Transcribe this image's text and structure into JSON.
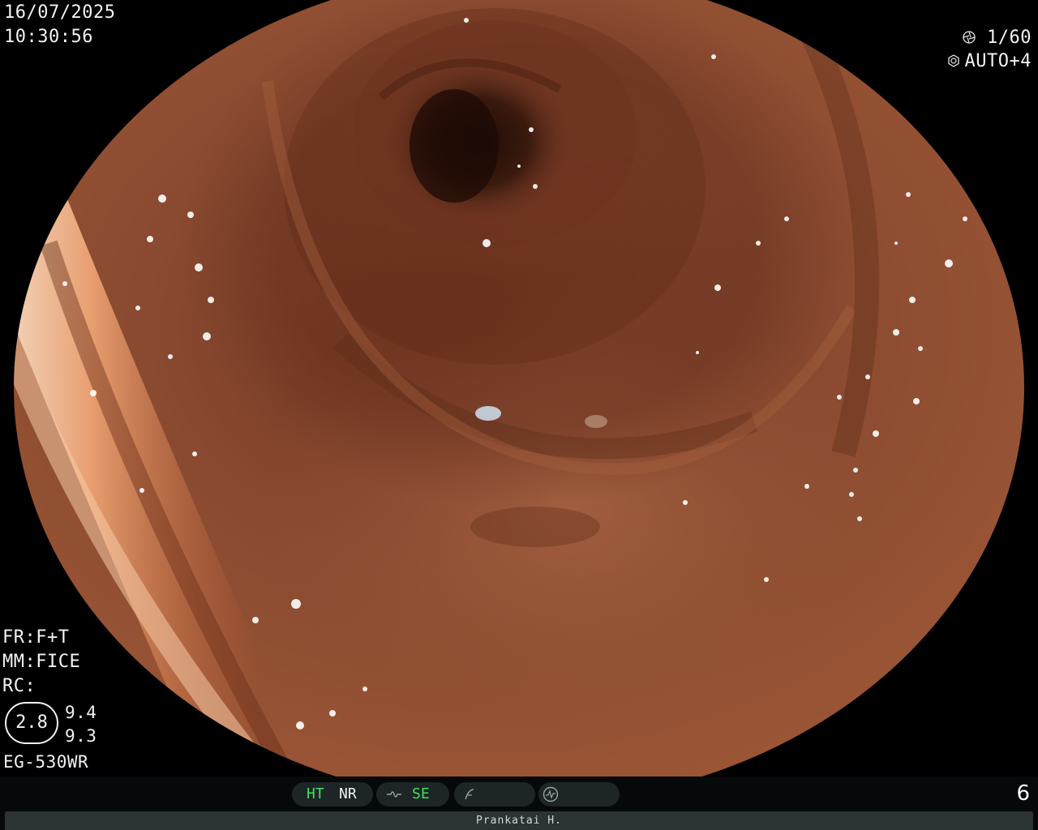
{
  "overlay": {
    "date": "16/07/2025",
    "time": "10:30:56",
    "shutter": "1/60",
    "auto": "AUTO+4"
  },
  "settings": {
    "fr": "FR:F+T",
    "mm": "MM:FICE",
    "rc": "RC:",
    "zoom": "2.8",
    "zoom_top": "9.4",
    "zoom_bottom": "9.3",
    "scope_model": "EG-530WR"
  },
  "function_bar": {
    "ht": "HT",
    "nr": "NR",
    "se": "SE",
    "page_number": "6"
  },
  "patient": {
    "name": "Prankatai H."
  },
  "colors": {
    "active_green": "#3fe05a",
    "mucosa": "#8a4a2e",
    "lumen": "#2a1208"
  },
  "icons": {
    "shutter": "aperture-icon",
    "auto": "brightness-icon",
    "enhancement": "wave-icon",
    "freeze": "slash-icon",
    "record": "circle-record-icon"
  }
}
